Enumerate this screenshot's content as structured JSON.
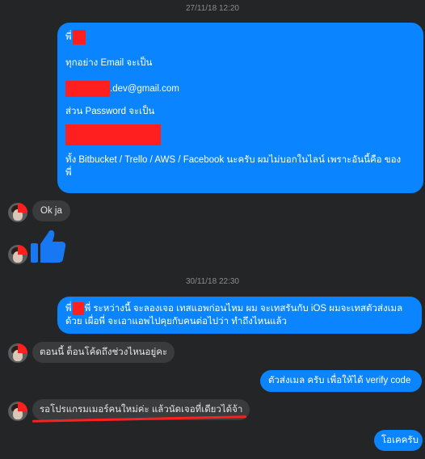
{
  "timestamps": {
    "first": "27/11/18 12:20",
    "second": "30/11/18 22:30"
  },
  "messages": {
    "email_block": {
      "salutation": "พี่",
      "email_intro": "ทุกอย่าง Email จะเป็น",
      "email_suffix": ".dev@gmail.com",
      "password_intro": "ส่วน Password จะเป็น",
      "services_line1": "ทั้ง Bitbucket / Trello / AWS / Facebook นะครับ ผมไม่บอกในไลน์ เพราะอันนี้คือ ของ",
      "services_line2": "พี่"
    },
    "reply_ok": "Ok ja",
    "plan_block": {
      "prefix": "พี่",
      "line1": "พี่ ระหว่างนี้ จะลองเจอ เทสแอพก่อนไหม ผม จะเทสรันกับ iOS ผมจะเทสตัวส่งเมล",
      "line2": "ด้วย เผื่อพี่ จะเอาแอพไปคุยกับคนต่อไปว่า ทำถึงไหนแล้ว"
    },
    "question": "ตอนนี้ ต็อนโค้ดถึงช่วงไหนอยู่คะ",
    "answer": "ตัวส่งเมล ครับ เพื่อให้ได้ verify code",
    "new_programmer": "รอโปรแกรมเมอร์คนใหม่ค่ะ แล้วนัดเจอที่เดียวได้จ้า",
    "ok_reply": "โอเคครับ"
  },
  "colors": {
    "background": "#242526",
    "outgoing_bubble": "#0a84ff",
    "incoming_bubble": "#3a3b3c",
    "redaction": "#ff1f1f"
  },
  "icons": [
    "like-thumb-icon",
    "avatar"
  ]
}
